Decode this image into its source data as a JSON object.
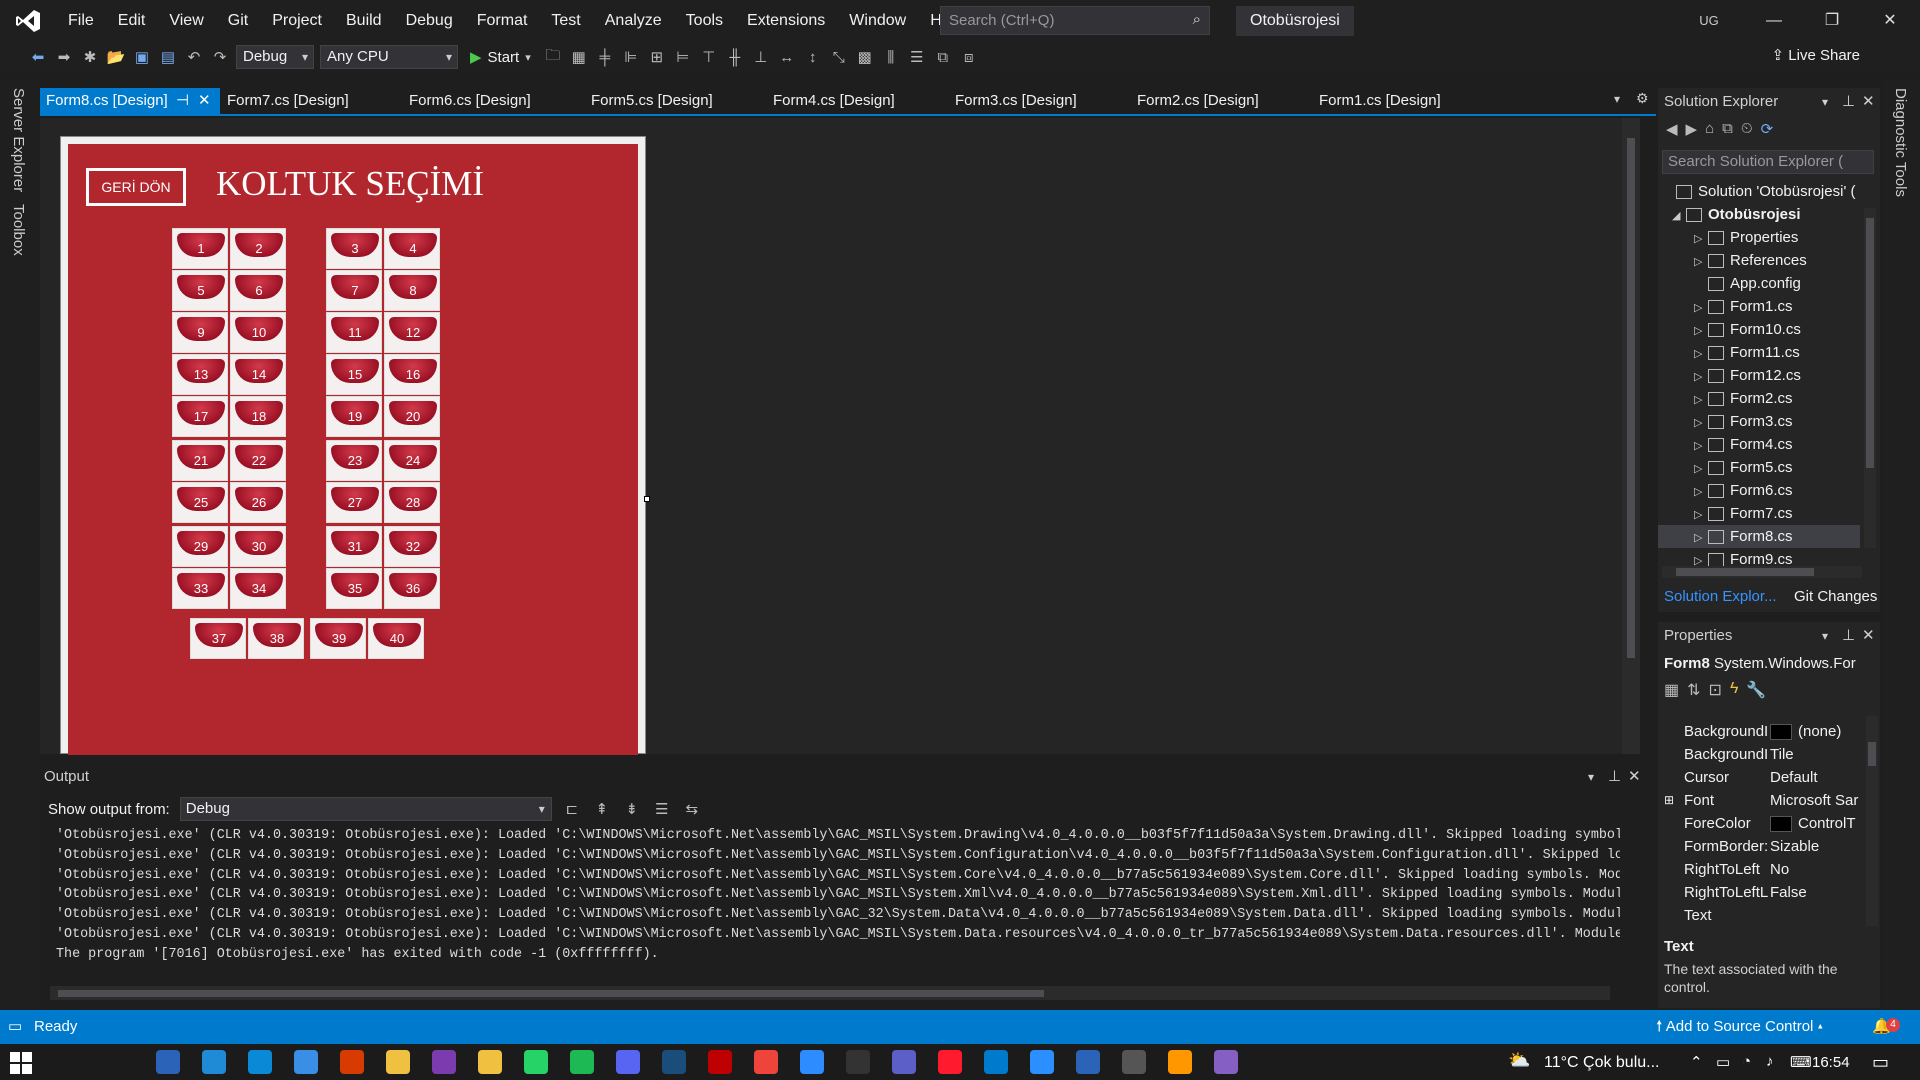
{
  "titlebar": {
    "menu": [
      "File",
      "Edit",
      "View",
      "Git",
      "Project",
      "Build",
      "Debug",
      "Format",
      "Test",
      "Analyze",
      "Tools",
      "Extensions",
      "Window",
      "Help"
    ],
    "search_placeholder": "Search (Ctrl+Q)",
    "solution_name": "Otobüsrojesi",
    "user_initials": "UG"
  },
  "toolbar": {
    "config": "Debug",
    "platform": "Any CPU",
    "start_label": "Start",
    "live_share": "Live Share"
  },
  "left_rail": [
    "Server Explorer",
    "Toolbox"
  ],
  "right_rail": [
    "Diagnostic Tools"
  ],
  "doc_tabs": [
    "Form8.cs [Design]",
    "Form7.cs [Design]",
    "Form6.cs [Design]",
    "Form5.cs [Design]",
    "Form4.cs [Design]",
    "Form3.cs [Design]",
    "Form2.cs [Design]",
    "Form1.cs [Design]"
  ],
  "form": {
    "back_button": "GERİ DÖN",
    "title": "KOLTUK SEÇİMİ",
    "seats": [
      "1",
      "2",
      "3",
      "4",
      "5",
      "6",
      "7",
      "8",
      "9",
      "10",
      "11",
      "12",
      "13",
      "14",
      "15",
      "16",
      "17",
      "18",
      "19",
      "20",
      "21",
      "22",
      "23",
      "24",
      "25",
      "26",
      "27",
      "28",
      "29",
      "30",
      "31",
      "32",
      "33",
      "34",
      "35",
      "36",
      "37",
      "38",
      "39",
      "40"
    ]
  },
  "output": {
    "title": "Output",
    "show_from_label": "Show output from:",
    "source": "Debug",
    "lines": [
      "'Otobüsrojesi.exe' (CLR v4.0.30319: Otobüsrojesi.exe): Loaded 'C:\\WINDOWS\\Microsoft.Net\\assembly\\GAC_MSIL\\System.Drawing\\v4.0_4.0.0.0__b03f5f7f11d50a3a\\System.Drawing.dll'. Skipped loading symbols.",
      "'Otobüsrojesi.exe' (CLR v4.0.30319: Otobüsrojesi.exe): Loaded 'C:\\WINDOWS\\Microsoft.Net\\assembly\\GAC_MSIL\\System.Configuration\\v4.0_4.0.0.0__b03f5f7f11d50a3a\\System.Configuration.dll'. Skipped load",
      "'Otobüsrojesi.exe' (CLR v4.0.30319: Otobüsrojesi.exe): Loaded 'C:\\WINDOWS\\Microsoft.Net\\assembly\\GAC_MSIL\\System.Core\\v4.0_4.0.0.0__b77a5c561934e089\\System.Core.dll'. Skipped loading symbols. Modul",
      "'Otobüsrojesi.exe' (CLR v4.0.30319: Otobüsrojesi.exe): Loaded 'C:\\WINDOWS\\Microsoft.Net\\assembly\\GAC_MSIL\\System.Xml\\v4.0_4.0.0.0__b77a5c561934e089\\System.Xml.dll'. Skipped loading symbols. Module",
      "'Otobüsrojesi.exe' (CLR v4.0.30319: Otobüsrojesi.exe): Loaded 'C:\\WINDOWS\\Microsoft.Net\\assembly\\GAC_32\\System.Data\\v4.0_4.0.0.0__b77a5c561934e089\\System.Data.dll'. Skipped loading symbols. Module",
      "'Otobüsrojesi.exe' (CLR v4.0.30319: Otobüsrojesi.exe): Loaded 'C:\\WINDOWS\\Microsoft.Net\\assembly\\GAC_MSIL\\System.Data.resources\\v4.0_4.0.0.0_tr_b77a5c561934e089\\System.Data.resources.dll'. Module w",
      "The program '[7016] Otobüsrojesi.exe' has exited with code -1 (0xffffffff)."
    ]
  },
  "solution_explorer": {
    "title": "Solution Explorer",
    "search_placeholder": "Search Solution Explorer (",
    "solution_label": "Solution 'Otobüsrojesi' (",
    "project": "Otobüsrojesi",
    "items": [
      "Properties",
      "References",
      "App.config",
      "Form1.cs",
      "Form10.cs",
      "Form11.cs",
      "Form12.cs",
      "Form2.cs",
      "Form3.cs",
      "Form4.cs",
      "Form5.cs",
      "Form6.cs",
      "Form7.cs",
      "Form8.cs",
      "Form9.cs"
    ],
    "selected": "Form8.cs",
    "tabs": [
      "Solution Explor...",
      "Git Changes"
    ]
  },
  "properties": {
    "title": "Properties",
    "object": "Form8",
    "type": "System.Windows.For",
    "rows": [
      {
        "name": "BackgroundI",
        "value": "(none)"
      },
      {
        "name": "BackgroundI",
        "value": "Tile"
      },
      {
        "name": "Cursor",
        "value": "Default"
      },
      {
        "name": "Font",
        "value": "Microsoft Sar"
      },
      {
        "name": "ForeColor",
        "value": "ControlT"
      },
      {
        "name": "FormBorder:",
        "value": "Sizable"
      },
      {
        "name": "RightToLeft",
        "value": "No"
      },
      {
        "name": "RightToLeftL",
        "value": "False"
      },
      {
        "name": "Text",
        "value": ""
      }
    ],
    "desc_title": "Text",
    "desc_body": "The text associated with the control."
  },
  "status": {
    "ready": "Ready",
    "source_control": "Add to Source Control",
    "notification_count": "4"
  },
  "taskbar": {
    "weather": "11°C  Çok bulu...",
    "time": "16:54"
  },
  "colors": {
    "accent": "#007acc",
    "form_bg": "#b1272d",
    "status": "#007acc"
  }
}
